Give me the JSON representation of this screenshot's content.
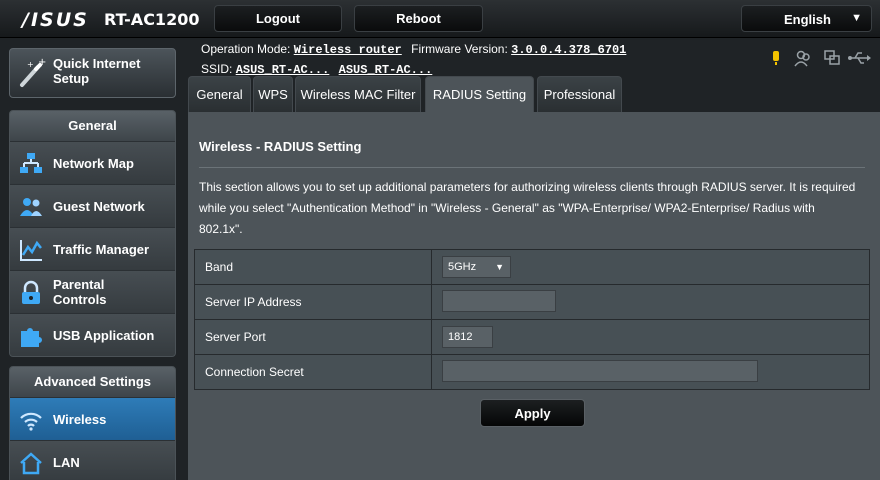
{
  "header": {
    "brand": "/ISUS",
    "model": "RT-AC1200",
    "logout": "Logout",
    "reboot": "Reboot",
    "language": "English"
  },
  "sidebar": {
    "quick_setup": "Quick Internet Setup",
    "general_head": "General",
    "general_items": [
      {
        "label": "Network Map",
        "icon": "network-map-icon"
      },
      {
        "label": "Guest Network",
        "icon": "guest-network-icon"
      },
      {
        "label": "Traffic Manager",
        "icon": "traffic-manager-icon"
      },
      {
        "label": "Parental Controls",
        "icon": "lock-icon"
      },
      {
        "label": "USB Application",
        "icon": "puzzle-icon"
      }
    ],
    "advanced_head": "Advanced Settings",
    "advanced_items": [
      {
        "label": "Wireless",
        "icon": "wifi-icon",
        "active": true
      },
      {
        "label": "LAN",
        "icon": "home-icon"
      }
    ]
  },
  "info": {
    "op_mode_label": "Operation Mode:",
    "op_mode_value": "Wireless router",
    "fw_label": "Firmware Version:",
    "fw_value": "3.0.0.4.378_6701",
    "ssid_label": "SSID:",
    "ssid_1": "ASUS_RT-AC...",
    "ssid_2": "ASUS_RT-AC..."
  },
  "tabs": [
    "General",
    "WPS",
    "Wireless MAC Filter",
    "RADIUS Setting",
    "Professional"
  ],
  "active_tab": "RADIUS Setting",
  "content": {
    "title": "Wireless - RADIUS Setting",
    "description": "This section allows you to set up additional parameters for authorizing wireless clients through RADIUS server. It is required while you select \"Authentication Method\" in \"Wireless - General\" as \"WPA-Enterprise/ WPA2-Enterprise/ Radius with 802.1x\".",
    "fields": {
      "band_label": "Band",
      "band_value": "5GHz",
      "server_ip_label": "Server IP Address",
      "server_ip_value": "",
      "server_port_label": "Server Port",
      "server_port_value": "1812",
      "secret_label": "Connection Secret",
      "secret_value": ""
    },
    "apply": "Apply"
  },
  "colors": {
    "active_item": "#2e7cb8",
    "status_icon_yellow": "#f2c200"
  }
}
